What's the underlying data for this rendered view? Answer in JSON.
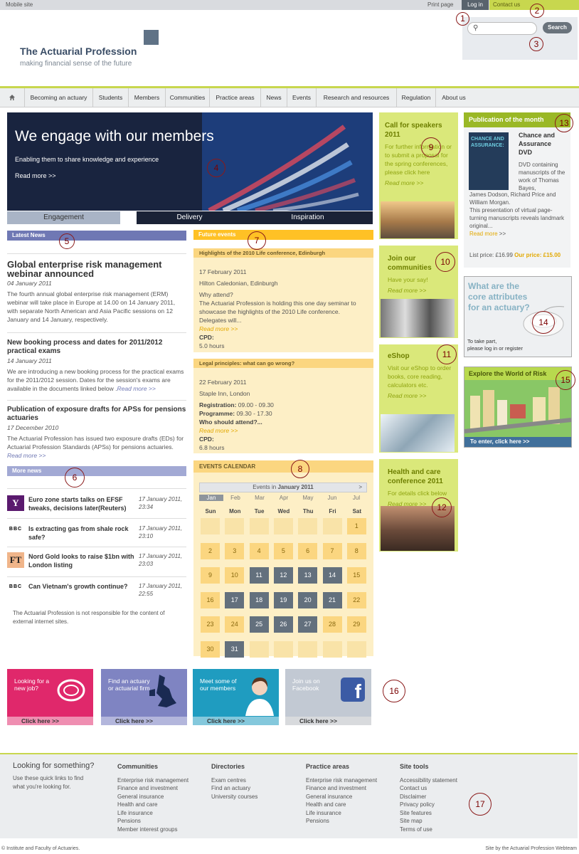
{
  "topbar": {
    "mobile": "Mobile site",
    "print": "Print page",
    "login": "Log in",
    "contact": "Contact us"
  },
  "header": {
    "title": "The Actuarial Profession",
    "tagline": "making financial sense of the future"
  },
  "search": {
    "button": "Search",
    "placeholder": ""
  },
  "nav": {
    "items": [
      "Becoming an actuary",
      "Students",
      "Members",
      "Communities",
      "Practice areas",
      "News",
      "Events",
      "Research and resources",
      "Regulation",
      "About us"
    ]
  },
  "hero": {
    "title": "We engage with our members",
    "subtitle": "Enabling them to share knowledge and experience",
    "readmore": "Read more >>",
    "tabs": [
      "Engagement",
      "Delivery",
      "Inspiration"
    ]
  },
  "latest_news": {
    "heading": "Latest News",
    "items": [
      {
        "title": "Global enterprise risk management webinar announced",
        "date": "04 January 2011",
        "body": "The fourth annual global enterprise risk management (ERM) webinar will take place in Europe at 14.00 on 14 January 2011, with separate North American and Asia Pacific sessions on 12 January and 14 January, respectively.",
        "more": ""
      },
      {
        "title": "New booking process and dates for 2011/2012 practical exams",
        "date": "14 January 2011",
        "body": "We are introducing a new booking process for the practical exams for the 2011/2012 session. Dates for the session's exams are available in the documents linked below .",
        "more": "Read more >>"
      },
      {
        "title": "Publication of exposure drafts for APSs for pensions actuaries",
        "date": "17 December 2010",
        "body": "The Actuarial Profession has issued two exposure drafts (EDs) for Actuarial Profession Standards (APSs) for pensions actuaries.",
        "more": "Read more >>"
      }
    ]
  },
  "more_news": {
    "heading": "More news",
    "items": [
      {
        "source": "Y",
        "title": "Euro zone starts talks on EFSF tweaks, decisions later(Reuters)",
        "date": "17 January 2011, 23:34"
      },
      {
        "source": "BBC",
        "title": "Is extracting gas from shale rock safe?",
        "date": "17 January 2011, 23:10"
      },
      {
        "source": "FT",
        "title": "Nord Gold looks to raise $1bn with London listing",
        "date": "17 January 2011, 23:03"
      },
      {
        "source": "BBC",
        "title": "Can Vietnam's growth continue?",
        "date": "17 January 2011, 22:55"
      }
    ],
    "disclaimer": "The Actuarial Profession is not responsible for the content of external internet sites."
  },
  "future_events": {
    "heading": "Future events",
    "events": [
      {
        "title": "Highlights of the 2010 Life conference, Edinburgh",
        "date": "17 February 2011",
        "venue": "Hilton Caledonian, Edinburgh",
        "why": "Why attend?",
        "body": "The Actuarial Profession is holding this one day seminar to showcase the highlights of the 2010 Life conference. Delegates will...",
        "readmore": "Read more >>",
        "cpd_label": "CPD:",
        "cpd": "5.0 hours"
      },
      {
        "title": "Legal principles: what can go wrong?",
        "date": "22 February 2011",
        "venue": "Staple Inn, London",
        "reg_label": "Registration:",
        "reg": "09.00 - 09.30",
        "prog_label": "Programme:",
        "prog": "09.30 - 17.30",
        "why": "Who should attend?...",
        "readmore": "Read more >>",
        "cpd_label": "CPD:",
        "cpd": "6.8 hours"
      }
    ]
  },
  "calendar": {
    "heading": "EVENTS CALENDAR",
    "events_in": "Events in",
    "month": "January 2011",
    "next": ">",
    "months": [
      "Jan",
      "Feb",
      "Mar",
      "Apr",
      "May",
      "Jun",
      "Jul"
    ],
    "dow": [
      "Sun",
      "Mon",
      "Tue",
      "Wed",
      "Thu",
      "Fri",
      "Sat"
    ],
    "days": [
      [
        "",
        "",
        "",
        "",
        "",
        "",
        "1"
      ],
      [
        "2",
        "3",
        "4",
        "5",
        "6",
        "7",
        "8"
      ],
      [
        "9",
        "10",
        "11",
        "12",
        "13",
        "14",
        "15"
      ],
      [
        "16",
        "17",
        "18",
        "19",
        "20",
        "21",
        "22"
      ],
      [
        "23",
        "24",
        "25",
        "26",
        "27",
        "28",
        "29"
      ],
      [
        "30",
        "31",
        "",
        "",
        "",
        "",
        ""
      ]
    ],
    "past_days": [
      "11",
      "12",
      "13",
      "14",
      "17",
      "18",
      "19",
      "20",
      "21",
      "25",
      "26",
      "27",
      "31"
    ]
  },
  "side_boxes": [
    {
      "title": "Call for speakers 2011",
      "body": "For further information or to submit a proposal for the spring conferences, please click here",
      "readmore": "Read more >>"
    },
    {
      "title": "Join our communities",
      "body": "Have your say!",
      "readmore": "Read more >>"
    },
    {
      "title": "eShop",
      "body": "Visit our eShop to order books, core reading, calculators etc.",
      "readmore": "Read more >>"
    },
    {
      "title": "Health and care conference 2011",
      "body": "For details click below",
      "readmore": "Read more >>"
    }
  ],
  "publication": {
    "heading": "Publication of the month",
    "cover_text": "CHANCE AND ASSURANCE:",
    "title": "Chance and Assurance DVD",
    "desc": "DVD containing manuscripts of the work of Thomas Bayes,",
    "desc2": "James Dodson, Richard Price and William Morgan.",
    "desc3": "This presentation of virtual page-turning manuscripts reveals landmark original...",
    "readmore": "Read more",
    "list_price": "List price: £16.99",
    "our_price_label": "Our price:",
    "our_price": "£15.00"
  },
  "core_attr": {
    "question": "What are the core attributes for an actuary?",
    "text1": "To take part,",
    "text2": "please log in or register"
  },
  "world": {
    "heading": "Explore the World of Risk",
    "footer": "To enter, click here >>"
  },
  "promos": [
    {
      "text": "Looking for a new job?",
      "footer": "Click here >>",
      "color": "#e0286b",
      "footer_color": "#ef8eb1"
    },
    {
      "text": "Find an actuary or actuarial firm",
      "footer": "Click here >>",
      "color": "#7f84c2",
      "footer_color": "#b3b6dc"
    },
    {
      "text": "Meet some of our members",
      "footer": "Click here >>",
      "color": "#1f9cc0",
      "footer_color": "#84c8dc"
    },
    {
      "text": "Join us on Facebook",
      "footer": "Click here >>",
      "color": "#c2c9d3",
      "footer_color": "#d8dadd"
    }
  ],
  "footer": {
    "looking": "Looking for something?",
    "desc": "Use these quick links to find what you're looking for.",
    "cols": [
      {
        "h": "Communities",
        "items": [
          "Enterprise risk management",
          "Finance and investment",
          "General insurance",
          "Health and care",
          "Life insurance",
          "Pensions",
          "Member interest groups"
        ]
      },
      {
        "h": "Directories",
        "items": [
          "Exam centres",
          "Find an actuary",
          "University courses"
        ]
      },
      {
        "h": "Practice areas",
        "items": [
          "Enterprise risk management",
          "Finance and investment",
          "General insurance",
          "Health and care",
          "Life insurance",
          "Pensions"
        ]
      },
      {
        "h": "Site tools",
        "items": [
          "Accessibility statement",
          "Contact us",
          "Disclaimer",
          "Privacy policy",
          "Site features",
          "Site map",
          "Terms of use"
        ]
      }
    ],
    "copyright": "© Institute and Faculty of Actuaries.",
    "credit": "Site by the Actuarial Profession Webteam"
  },
  "markers": [
    "1",
    "2",
    "3",
    "4",
    "5",
    "6",
    "7",
    "8",
    "9",
    "10",
    "11",
    "12",
    "13",
    "14",
    "15",
    "16",
    "17"
  ],
  "colors": {
    "green": "#c8d74e",
    "news": "#6f78b4",
    "events": "#ffc125",
    "past_day": "#63707d"
  }
}
